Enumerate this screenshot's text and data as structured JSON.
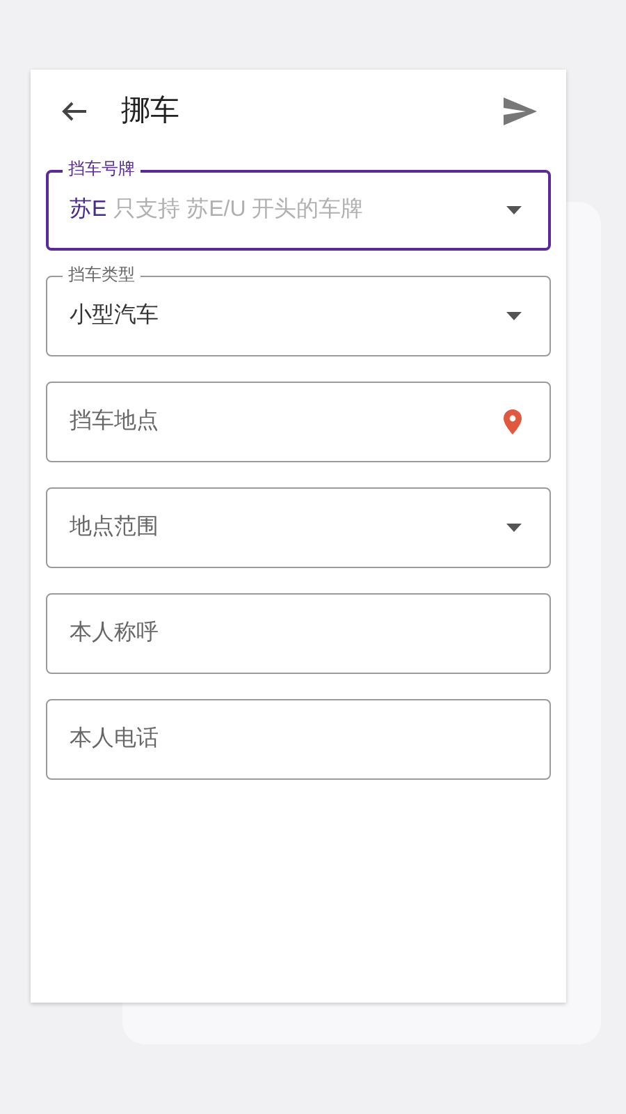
{
  "app_bar": {
    "title": "挪车"
  },
  "fields": [
    {
      "kind": "select",
      "label": "挡车号牌",
      "prefix": "苏E",
      "placeholder": "只支持 苏E/U 开头的车牌",
      "focused": true
    },
    {
      "kind": "select",
      "label": "挡车类型",
      "value": "小型汽车",
      "focused": false
    },
    {
      "kind": "location",
      "placeholder": "挡车地点",
      "focused": false
    },
    {
      "kind": "select",
      "placeholder": "地点范围",
      "focused": false
    },
    {
      "kind": "text",
      "placeholder": "本人称呼",
      "focused": false
    },
    {
      "kind": "text",
      "placeholder": "本人电话",
      "focused": false
    }
  ]
}
